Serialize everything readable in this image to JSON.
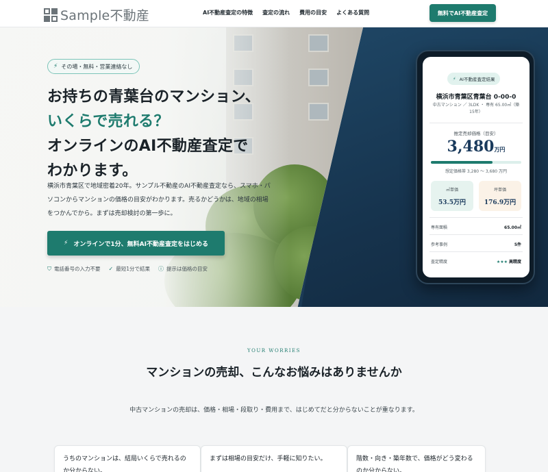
{
  "header": {
    "logo_text": "Sample不動産",
    "nav": [
      "AI不動産査定の特徴",
      "査定の流れ",
      "費用の目安",
      "よくある質問"
    ],
    "cta": "無料でAI不動産査定"
  },
  "hero": {
    "badge": "その場・無料・営業連絡なし",
    "headline_1": "お持ちの青葉台のマンション、",
    "headline_2": "いくらで売れる？",
    "headline_3": "オンラインのAI不動産査定で",
    "headline_4": "わかります。",
    "lead": "横浜市青葉区で地域密着20年。サンプル不動産のAI不動産査定なら、スマホ・パソコンからマンションの価格の目安がわかります。売るかどうかは、地域の相場をつかんでから。まずは売却検討の第一歩に。",
    "cta": "オンラインで1分、無料AI不動産査定をはじめる",
    "features": [
      {
        "icon": "shield-icon",
        "text": "電話番号の入力不要"
      },
      {
        "icon": "check-icon",
        "text": "最短1分で結果"
      },
      {
        "icon": "info-icon",
        "text": "提示は価格の目安"
      }
    ]
  },
  "phone": {
    "badge": "AI不動産査定結果",
    "title": "横浜市青葉区青葉台 0-00-0",
    "subtitle": "中古マンション ／ 3LDK ・ 専有 65.00㎡（築15年）",
    "price_label": "推定売却価格（目安）",
    "price": "3,480",
    "price_unit": "万円",
    "range_fill": 0.68,
    "range": "想定価格帯 3,280 〜 3,680 万円",
    "unit_sqm_label": "㎡単価",
    "unit_sqm_value": "53.5万円",
    "unit_tsubo_label": "坪単価",
    "unit_tsubo_value": "176.9万円",
    "rows": [
      {
        "label": "専有面積",
        "value": "65.00㎡"
      },
      {
        "label": "参考事例",
        "value": "5件"
      },
      {
        "label": "査定精度",
        "stars": "★★★",
        "value": "高精度"
      }
    ]
  },
  "worries": {
    "eyebrow": "YOUR WORRIES",
    "title": "マンションの売却、こんなお悩みはありませんか",
    "sub": "中古マンションの売却は、価格・相場・段取り・費用まで、はじめてだと分からないことが重なります。",
    "cards": [
      "うちのマンションは、結局いくらで売れるのか分からない。",
      "まずは相場の目安だけ、手軽に知りたい。",
      "階数・向き・築年数で、価格がどう変わるのか分からない。"
    ]
  },
  "colors": {
    "accent": "#1e7b6e",
    "navy": "#1b3a56",
    "price": "#1a3a5c"
  }
}
